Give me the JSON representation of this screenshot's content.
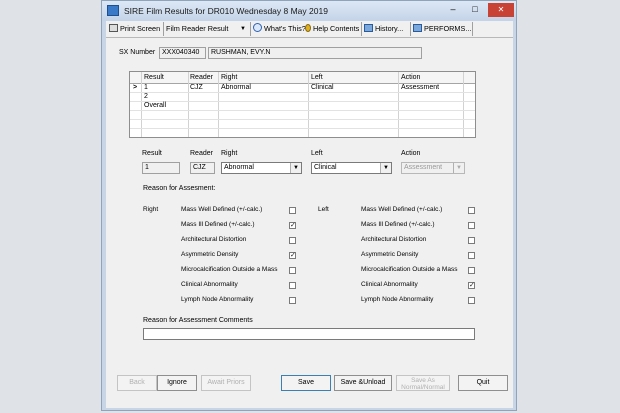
{
  "window": {
    "title": "SIRE Film Results for DR010 Wednesday 8 May 2019"
  },
  "titlebar_buttons": {
    "minimize": "–",
    "maximize": "□",
    "close": "✕"
  },
  "toolbar": {
    "print_screen": "Print Screen",
    "report_select": "Film Reader Result",
    "whats_this": "What's This?",
    "help_contents": "Help Contents",
    "history": "History...",
    "performs": "PERFORMS..."
  },
  "client": {
    "sx_label": "SX Number",
    "sx_number": "XXX040340",
    "patient_name": "RUSHMAN, EVY.N"
  },
  "results_table": {
    "headers": [
      "Result",
      "Reader",
      "Right",
      "Left",
      "Action"
    ],
    "pointer": ">",
    "rows": [
      {
        "result": "1",
        "reader": "CJZ",
        "right": "Abnormal",
        "left": "Clinical",
        "action": "Assessment"
      },
      {
        "result": "2",
        "reader": "",
        "right": "",
        "left": "",
        "action": ""
      },
      {
        "result": "Overall",
        "reader": "",
        "right": "",
        "left": "",
        "action": ""
      }
    ]
  },
  "entry": {
    "result_label": "Result",
    "result_value": "1",
    "reader_label": "Reader",
    "reader_value": "CJZ",
    "right_label": "Right",
    "right_value": "Abnormal",
    "left_label": "Left",
    "left_value": "Clinical",
    "action_label": "Action",
    "action_value": "Assessment"
  },
  "reasons": {
    "heading": "Reason for Assesment:",
    "right_label": "Right",
    "left_label": "Left",
    "right_items": [
      {
        "label": "Mass Well Defined (+/-calc.)",
        "checked": false
      },
      {
        "label": "Mass Ill Defined (+/-calc.)",
        "checked": true
      },
      {
        "label": "Architectural Distortion",
        "checked": false
      },
      {
        "label": "Asymmetric Density",
        "checked": true
      },
      {
        "label": "Microcalcification Outside a Mass",
        "checked": false
      },
      {
        "label": "Clinical Abnormality",
        "checked": false
      },
      {
        "label": "Lymph Node Abnormality",
        "checked": false
      }
    ],
    "left_items": [
      {
        "label": "Mass Well Defined (+/-calc.)",
        "checked": false
      },
      {
        "label": "Mass Ill Defined (+/-calc.)",
        "checked": false
      },
      {
        "label": "Architectural Distortion",
        "checked": false
      },
      {
        "label": "Asymmetric Density",
        "checked": false
      },
      {
        "label": "Microcalcification Outside a Mass",
        "checked": false
      },
      {
        "label": "Clinical Abnormality",
        "checked": true
      },
      {
        "label": "Lymph Node Abnormality",
        "checked": false
      }
    ],
    "check_glyph": "✓",
    "comments_label": "Reason for Assessment Comments",
    "comments_value": ""
  },
  "buttons": {
    "back": "Back",
    "ignore": "Ignore",
    "await_priors": "Await Priors",
    "save": "Save",
    "save_unload": "Save &Unload",
    "save_as_1": "Save As",
    "save_as_2": "Normal/Normal",
    "quit": "Quit"
  },
  "colors": {
    "window_frame": "#c7d5e6",
    "client_bg": "#f0f0f0",
    "desktop": "#dfe3e8"
  }
}
